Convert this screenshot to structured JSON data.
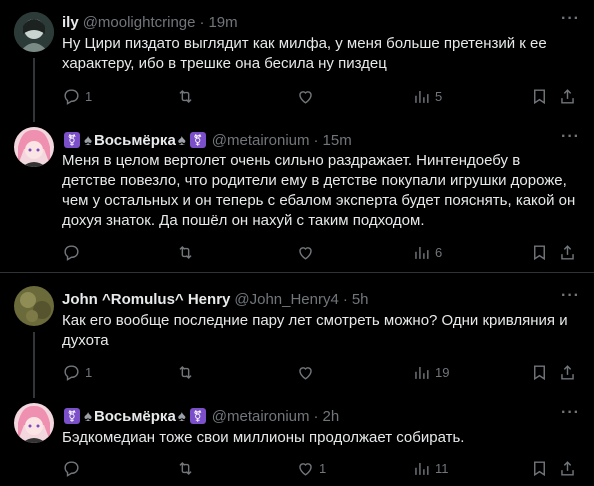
{
  "tweets": [
    {
      "name": "ily",
      "handle": "@moolightcringe",
      "time": "19m",
      "text": "Ну Цири пиздато выглядит как милфа, у меня больше претензий к ее характеру, ибо в трешке она бесила ну пиздец",
      "reply_count": "1",
      "retweet_count": "",
      "like_count": "",
      "view_count": "5"
    },
    {
      "name": "Восьмёрка",
      "handle": "@metaironium",
      "time": "15m",
      "text": "Меня в целом вертолет очень сильно раздражает. Нинтендоебу в детстве повезло, что родители ему в детстве покупали игрушки дороже, чем у остальных и он теперь с ебалом эксперта будет пояснять, какой он дохуя знаток. Да пошёл он нахуй с таким подходом.",
      "reply_count": "",
      "retweet_count": "",
      "like_count": "",
      "view_count": "6"
    },
    {
      "name": "John ^Romulus^ Henry",
      "handle": "@John_Henry4",
      "time": "5h",
      "text": "Как его вообще последние пару лет смотреть можно? Одни кривляния и духота",
      "reply_count": "1",
      "retweet_count": "",
      "like_count": "",
      "view_count": "19"
    },
    {
      "name": "Восьмёрка",
      "handle": "@metaironium",
      "time": "2h",
      "text": "Бэдкомедиан тоже свои миллионы продолжает собирать.",
      "reply_count": "",
      "retweet_count": "",
      "like_count": "1",
      "view_count": "11"
    }
  ],
  "ui": {
    "dot": "·",
    "more": "···"
  },
  "colors": {
    "bg": "#000000",
    "text": "#e7e9ea",
    "muted": "#71767b",
    "divider": "#2f3336"
  }
}
